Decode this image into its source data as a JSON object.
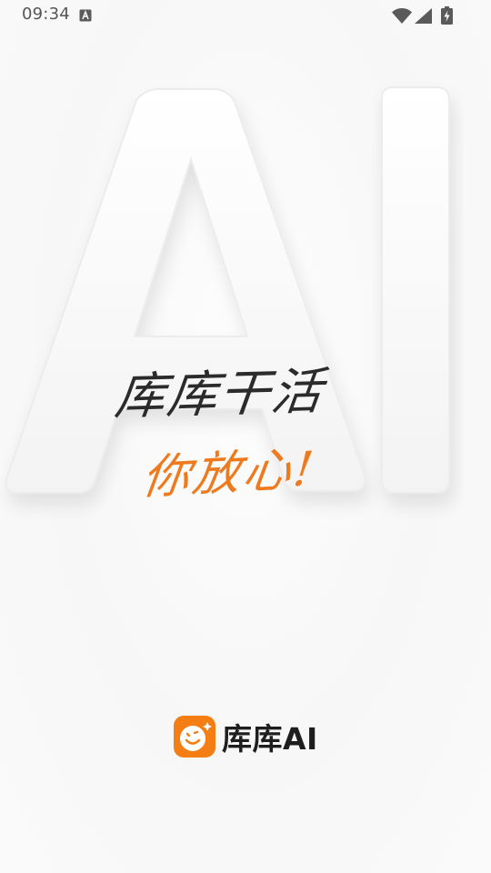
{
  "status_bar": {
    "time": "09:34",
    "icons": [
      "keyboard-a-icon",
      "wifi-icon",
      "cell-signal-icon",
      "battery-charging-icon"
    ]
  },
  "splash": {
    "background_text": "AI",
    "slogan_line_1": "库库干活",
    "slogan_line_2": "你放心!"
  },
  "brand": {
    "logo_icon": "smiley-face-logo-icon",
    "name": "库库AI"
  },
  "colors": {
    "accent": "#F57E14",
    "slogan_orange": "#EE7A1D",
    "text_dark": "#1E1E1E",
    "status_gray": "#555555"
  }
}
